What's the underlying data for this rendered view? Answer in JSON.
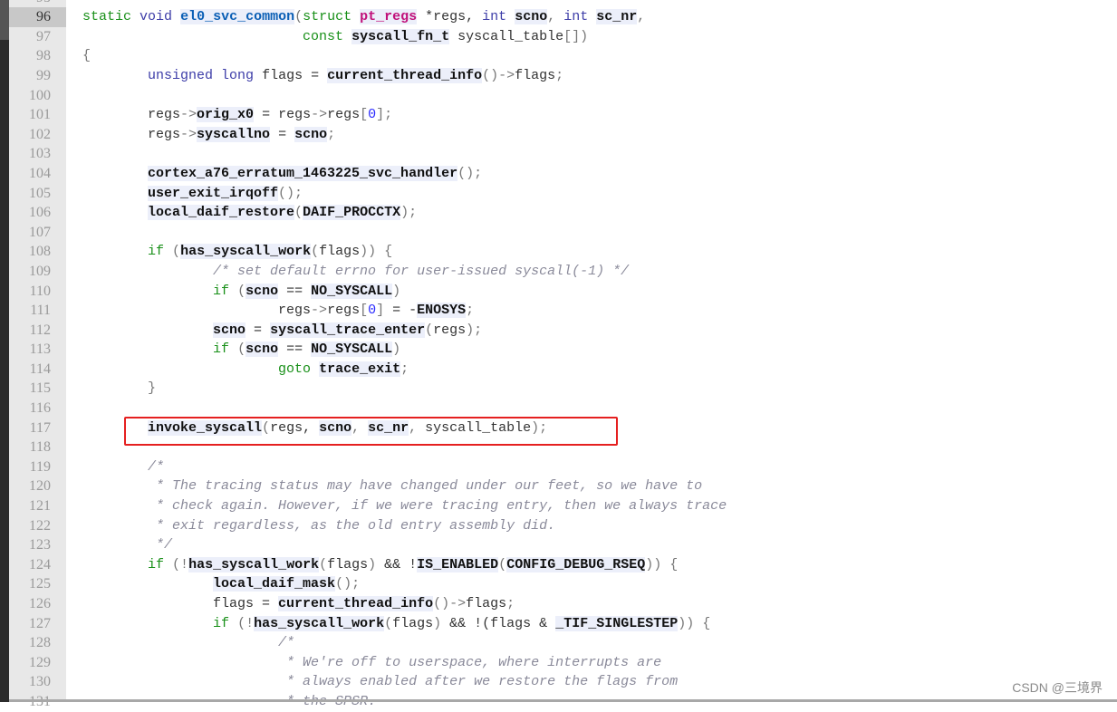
{
  "editor": {
    "current_line": 96,
    "highlight_line": 117,
    "highlight_color": "#e52020",
    "first_line": 95,
    "lines": [
      [],
      [
        [
          "k",
          "static"
        ],
        [
          "p",
          " "
        ],
        [
          "t",
          "void"
        ],
        [
          "p",
          " "
        ],
        [
          "h",
          "el0_svc_common"
        ],
        [
          "o",
          "("
        ],
        [
          "k",
          "struct"
        ],
        [
          "p",
          " "
        ],
        [
          "s",
          "pt_regs"
        ],
        [
          "p",
          " *regs, "
        ],
        [
          "t",
          "int"
        ],
        [
          "p",
          " "
        ],
        [
          "f",
          "scno"
        ],
        [
          "o",
          ", "
        ],
        [
          "t",
          "int"
        ],
        [
          "p",
          " "
        ],
        [
          "f",
          "sc_nr"
        ],
        [
          "o",
          ","
        ]
      ],
      [
        [
          "p",
          "                           "
        ],
        [
          "k",
          "const"
        ],
        [
          "p",
          " "
        ],
        [
          "f",
          "syscall_fn_t"
        ],
        [
          "p",
          " syscall_table"
        ],
        [
          "o",
          "[])"
        ]
      ],
      [
        [
          "o",
          "{"
        ]
      ],
      [
        [
          "p",
          "        "
        ],
        [
          "t",
          "unsigned"
        ],
        [
          "p",
          " "
        ],
        [
          "t",
          "long"
        ],
        [
          "p",
          " flags = "
        ],
        [
          "f",
          "current_thread_info"
        ],
        [
          "o",
          "()->"
        ],
        [
          "p",
          "flags"
        ],
        [
          "o",
          ";"
        ]
      ],
      [],
      [
        [
          "p",
          "        regs"
        ],
        [
          "o",
          "->"
        ],
        [
          "f",
          "orig_x0"
        ],
        [
          "p",
          " = regs"
        ],
        [
          "o",
          "->"
        ],
        [
          "p",
          "regs"
        ],
        [
          "o",
          "["
        ],
        [
          "n",
          "0"
        ],
        [
          "o",
          "];"
        ]
      ],
      [
        [
          "p",
          "        regs"
        ],
        [
          "o",
          "->"
        ],
        [
          "f",
          "syscallno"
        ],
        [
          "p",
          " = "
        ],
        [
          "f",
          "scno"
        ],
        [
          "o",
          ";"
        ]
      ],
      [],
      [
        [
          "p",
          "        "
        ],
        [
          "f",
          "cortex_a76_erratum_1463225_svc_handler"
        ],
        [
          "o",
          "();"
        ]
      ],
      [
        [
          "p",
          "        "
        ],
        [
          "f",
          "user_exit_irqoff"
        ],
        [
          "o",
          "();"
        ]
      ],
      [
        [
          "p",
          "        "
        ],
        [
          "f",
          "local_daif_restore"
        ],
        [
          "o",
          "("
        ],
        [
          "f",
          "DAIF_PROCCTX"
        ],
        [
          "o",
          ");"
        ]
      ],
      [],
      [
        [
          "p",
          "        "
        ],
        [
          "k",
          "if"
        ],
        [
          "p",
          " "
        ],
        [
          "o",
          "("
        ],
        [
          "f",
          "has_syscall_work"
        ],
        [
          "o",
          "("
        ],
        [
          "p",
          "flags"
        ],
        [
          "o",
          "))"
        ],
        [
          "p",
          " "
        ],
        [
          "o",
          "{"
        ]
      ],
      [
        [
          "p",
          "                "
        ],
        [
          "c",
          "/* set default errno for user-issued syscall(-1) */"
        ]
      ],
      [
        [
          "p",
          "                "
        ],
        [
          "k",
          "if"
        ],
        [
          "p",
          " "
        ],
        [
          "o",
          "("
        ],
        [
          "f",
          "scno"
        ],
        [
          "p",
          " == "
        ],
        [
          "f",
          "NO_SYSCALL"
        ],
        [
          "o",
          ")"
        ]
      ],
      [
        [
          "p",
          "                        regs"
        ],
        [
          "o",
          "->"
        ],
        [
          "p",
          "regs"
        ],
        [
          "o",
          "["
        ],
        [
          "n",
          "0"
        ],
        [
          "o",
          "]"
        ],
        [
          "p",
          " = -"
        ],
        [
          "f",
          "ENOSYS"
        ],
        [
          "o",
          ";"
        ]
      ],
      [
        [
          "p",
          "                "
        ],
        [
          "f",
          "scno"
        ],
        [
          "p",
          " = "
        ],
        [
          "f",
          "syscall_trace_enter"
        ],
        [
          "o",
          "("
        ],
        [
          "p",
          "regs"
        ],
        [
          "o",
          ");"
        ]
      ],
      [
        [
          "p",
          "                "
        ],
        [
          "k",
          "if"
        ],
        [
          "p",
          " "
        ],
        [
          "o",
          "("
        ],
        [
          "f",
          "scno"
        ],
        [
          "p",
          " == "
        ],
        [
          "f",
          "NO_SYSCALL"
        ],
        [
          "o",
          ")"
        ]
      ],
      [
        [
          "p",
          "                        "
        ],
        [
          "k",
          "goto"
        ],
        [
          "p",
          " "
        ],
        [
          "f",
          "trace_exit"
        ],
        [
          "o",
          ";"
        ]
      ],
      [
        [
          "p",
          "        "
        ],
        [
          "o",
          "}"
        ]
      ],
      [],
      [
        [
          "p",
          "        "
        ],
        [
          "f",
          "invoke_syscall"
        ],
        [
          "o",
          "("
        ],
        [
          "p",
          "regs, "
        ],
        [
          "f",
          "scno"
        ],
        [
          "o",
          ", "
        ],
        [
          "f",
          "sc_nr"
        ],
        [
          "o",
          ", "
        ],
        [
          "p",
          "syscall_table"
        ],
        [
          "o",
          ");"
        ]
      ],
      [],
      [
        [
          "p",
          "        "
        ],
        [
          "c",
          "/*"
        ]
      ],
      [
        [
          "p",
          "        "
        ],
        [
          "c",
          " * The tracing status may have changed under our feet, so we have to"
        ]
      ],
      [
        [
          "p",
          "        "
        ],
        [
          "c",
          " * check again. However, if we were tracing entry, then we always trace"
        ]
      ],
      [
        [
          "p",
          "        "
        ],
        [
          "c",
          " * exit regardless, as the old entry assembly did."
        ]
      ],
      [
        [
          "p",
          "        "
        ],
        [
          "c",
          " */"
        ]
      ],
      [
        [
          "p",
          "        "
        ],
        [
          "k",
          "if"
        ],
        [
          "p",
          " "
        ],
        [
          "o",
          "(!"
        ],
        [
          "f",
          "has_syscall_work"
        ],
        [
          "o",
          "("
        ],
        [
          "p",
          "flags"
        ],
        [
          "o",
          ")"
        ],
        [
          "p",
          " && !"
        ],
        [
          "f",
          "IS_ENABLED"
        ],
        [
          "o",
          "("
        ],
        [
          "f",
          "CONFIG_DEBUG_RSEQ"
        ],
        [
          "o",
          "))"
        ],
        [
          "p",
          " "
        ],
        [
          "o",
          "{"
        ]
      ],
      [
        [
          "p",
          "                "
        ],
        [
          "f",
          "local_daif_mask"
        ],
        [
          "o",
          "();"
        ]
      ],
      [
        [
          "p",
          "                flags = "
        ],
        [
          "f",
          "current_thread_info"
        ],
        [
          "o",
          "()->"
        ],
        [
          "p",
          "flags"
        ],
        [
          "o",
          ";"
        ]
      ],
      [
        [
          "p",
          "                "
        ],
        [
          "k",
          "if"
        ],
        [
          "p",
          " "
        ],
        [
          "o",
          "(!"
        ],
        [
          "f",
          "has_syscall_work"
        ],
        [
          "o",
          "("
        ],
        [
          "p",
          "flags"
        ],
        [
          "o",
          ")"
        ],
        [
          "p",
          " && !(flags & "
        ],
        [
          "f",
          "_TIF_SINGLESTEP"
        ],
        [
          "o",
          "))"
        ],
        [
          "p",
          " "
        ],
        [
          "o",
          "{"
        ]
      ],
      [
        [
          "p",
          "                        "
        ],
        [
          "c",
          "/*"
        ]
      ],
      [
        [
          "p",
          "                        "
        ],
        [
          "c",
          " * We're off to userspace, where interrupts are"
        ]
      ],
      [
        [
          "p",
          "                        "
        ],
        [
          "c",
          " * always enabled after we restore the flags from"
        ]
      ],
      [
        [
          "p",
          "                        "
        ],
        [
          "c",
          " * the SPSR."
        ]
      ]
    ]
  },
  "watermark": "CSDN @三境界"
}
